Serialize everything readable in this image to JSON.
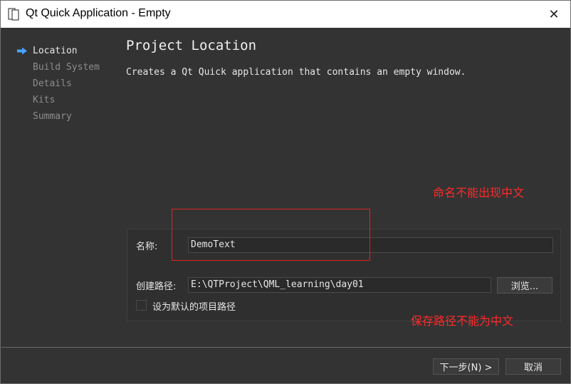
{
  "window": {
    "title": "Qt Quick Application - Empty",
    "close_glyph": "✕"
  },
  "nav": {
    "items": [
      {
        "label": "Location",
        "active": true
      },
      {
        "label": "Build System",
        "active": false
      },
      {
        "label": "Details",
        "active": false
      },
      {
        "label": "Kits",
        "active": false
      },
      {
        "label": "Summary",
        "active": false
      }
    ]
  },
  "page": {
    "heading": "Project Location",
    "description": "Creates a Qt Quick application that contains an empty window."
  },
  "annotations": {
    "name_note": "命名不能出现中文",
    "path_note": "保存路径不能为中文",
    "color": "#ff2a2a"
  },
  "form": {
    "name_label": "名称:",
    "name_value": "DemoText",
    "path_label": "创建路径:",
    "path_value": "E:\\QTProject\\QML_learning\\day01",
    "browse_label": "浏览...",
    "default_path_label": "设为默认的项目路径",
    "default_path_checked": false
  },
  "footer": {
    "next_label": "下一步(N) >",
    "cancel_label": "取消"
  }
}
